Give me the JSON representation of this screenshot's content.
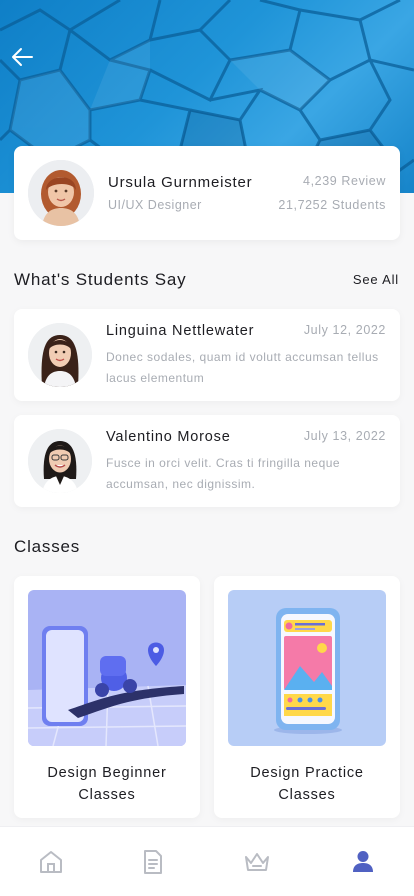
{
  "profile": {
    "name": "Ursula Gurnmeister",
    "role": "UI/UX Designer",
    "reviews": "4,239 Review",
    "students": "21,7252 Students"
  },
  "reviews_section": {
    "title": "What's Students Say",
    "see_all": "See All",
    "items": [
      {
        "name": "Linguina Nettlewater",
        "date": "July 12, 2022",
        "text": "Donec sodales, quam id volutt accumsan tellus lacus elementum"
      },
      {
        "name": "Valentino Morose",
        "date": "July 13, 2022",
        "text": "Fusce in orci velit. Cras ti fringilla neque accumsan, nec dignissim."
      }
    ]
  },
  "classes_section": {
    "title": "Classes",
    "items": [
      {
        "title": "Design Beginner Classes"
      },
      {
        "title": "Design Practice Classes"
      }
    ]
  },
  "nav": {
    "items": [
      "home-icon",
      "document-icon",
      "crown-icon",
      "profile-icon"
    ],
    "active": "profile-icon",
    "active_color": "#5061c2",
    "inactive_color": "#b9bcc3"
  },
  "colors": {
    "hero_blue": "#1f94d8",
    "muted_text": "#a8acb3"
  }
}
